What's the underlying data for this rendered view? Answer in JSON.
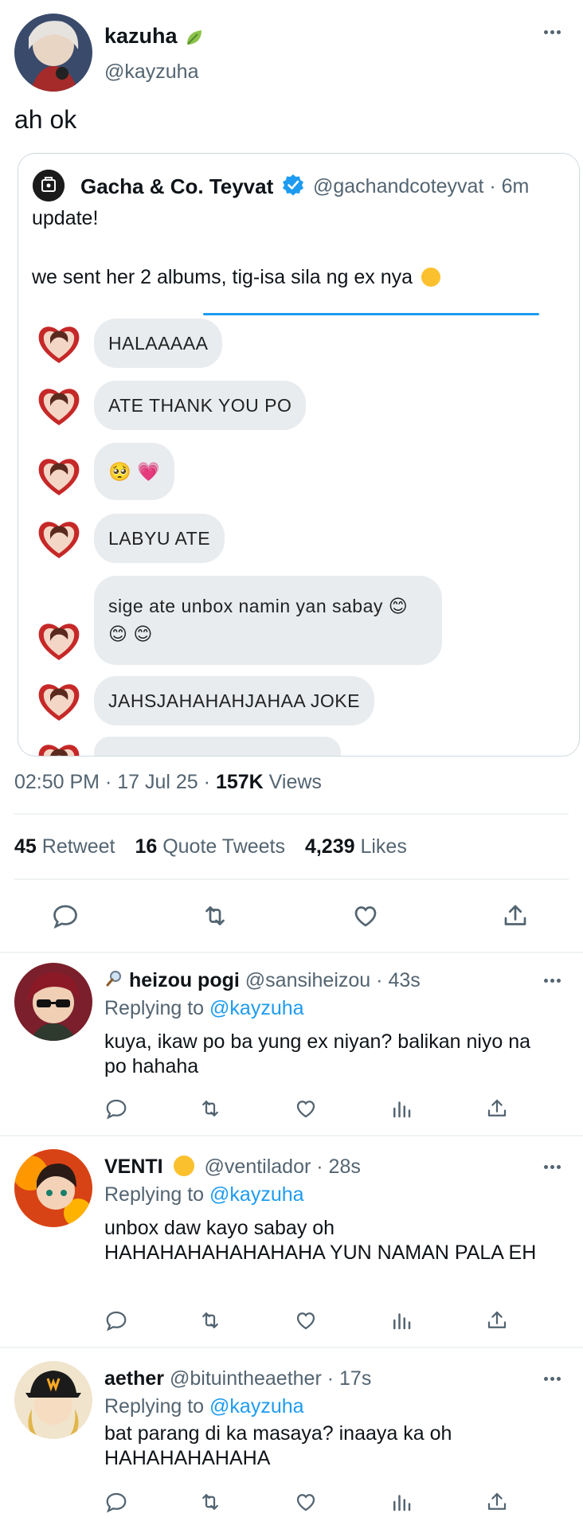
{
  "main_tweet": {
    "display_name": "kazuha",
    "handle": "@kayzuha",
    "text": "ah ok",
    "timestamp_time": "02:50 PM",
    "timestamp_date": "17 Jul 25",
    "views_count": "157K",
    "views_label": "Views",
    "retweets_count": "45",
    "retweets_label": "Retweet",
    "quotes_count": "16",
    "quotes_label": "Quote Tweets",
    "likes_count": "4,239",
    "likes_label": "Likes"
  },
  "quoted_tweet": {
    "display_name": "Gacha & Co. Teyvat",
    "handle": "@gachandcoteyvat",
    "time": "6m",
    "text_line1": "update!",
    "text_line2": "we sent her 2 albums, tig-isa sila ng ex nya",
    "chat_messages": [
      {
        "text": "HALAAAAA"
      },
      {
        "text": "ATE THANK YOU PO"
      },
      {
        "text": "🥺 💗"
      },
      {
        "text": "LABYU ATE"
      },
      {
        "text": "sige ate unbox namin yan sabay 😊"
      },
      {
        "text": "😊 😊"
      },
      {
        "text": "JAHSJAHAHAHJAHAA JOKE"
      }
    ]
  },
  "replies": [
    {
      "name": "heizou pogi",
      "handle": "@sansiheizou",
      "time": "43s",
      "replying_prefix": "Replying to",
      "replying_to": "@kayzuha",
      "text": "kuya, ikaw po ba yung ex niyan? balikan niyo na po hahaha"
    },
    {
      "name": "VENTI",
      "handle": "@ventilador",
      "time": "28s",
      "replying_prefix": "Replying to",
      "replying_to": "@kayzuha",
      "text": "unbox daw kayo sabay oh HAHAHAHAHAHAHAHA YUN NAMAN PALA EH"
    },
    {
      "name": "aether",
      "handle": "@bituintheaether",
      "time": "17s",
      "replying_prefix": "Replying to",
      "replying_to": "@kayzuha",
      "text": "bat parang di ka masaya? inaaya ka oh HAHAHAHAHAHA"
    }
  ],
  "colors": {
    "accent": "#1d9bf0",
    "muted": "#536471",
    "text": "#0f1419",
    "divider": "#eff3f4",
    "bubble": "#e9ecef"
  },
  "icons": [
    "reply-icon",
    "retweet-icon",
    "like-icon",
    "share-icon",
    "analytics-icon",
    "more-icon",
    "verified-badge-icon",
    "leaf-icon",
    "magnifier-icon",
    "tongue-emoji-icon"
  ]
}
